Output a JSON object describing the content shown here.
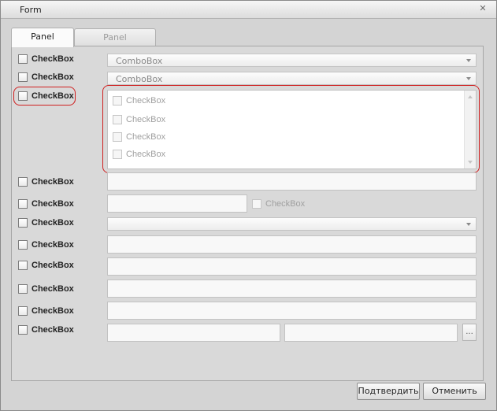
{
  "window": {
    "title": "Form",
    "close_icon": "close-icon"
  },
  "tabs": [
    {
      "label": "Panel",
      "active": true
    },
    {
      "label": "Panel",
      "active": false
    }
  ],
  "rows": {
    "r1": {
      "checkbox": "CheckBox",
      "combo": "ComboBox"
    },
    "r2": {
      "checkbox": "CheckBox",
      "combo": "ComboBox"
    },
    "r3": {
      "checkbox": "CheckBox",
      "list_items": [
        "CheckBox",
        "CheckBox",
        "CheckBox",
        "CheckBox"
      ]
    },
    "r4": {
      "checkbox": "CheckBox"
    },
    "r5": {
      "checkbox": "CheckBox",
      "inline_checkbox": "CheckBox"
    },
    "r6": {
      "checkbox": "CheckBox",
      "combo": ""
    },
    "r7": {
      "checkbox": "CheckBox"
    },
    "r8": {
      "checkbox": "CheckBox"
    },
    "r9": {
      "checkbox": "CheckBox"
    },
    "r10": {
      "checkbox": "CheckBox"
    },
    "r11": {
      "checkbox": "CheckBox",
      "ellipsis": "..."
    }
  },
  "buttons": {
    "confirm": "Подтвердить",
    "cancel": "Отменить"
  },
  "colors": {
    "highlight": "#d02020"
  }
}
